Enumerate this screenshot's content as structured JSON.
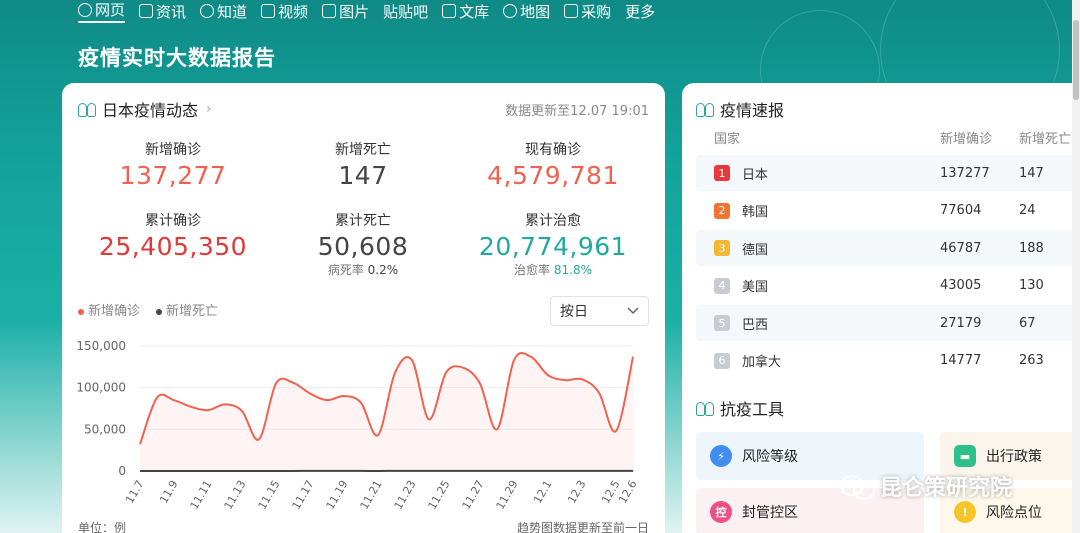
{
  "nav": {
    "items": [
      {
        "label": "网页",
        "icon": "search-icon",
        "active": true
      },
      {
        "label": "资讯",
        "icon": "news-icon"
      },
      {
        "label": "知道",
        "icon": "question-icon"
      },
      {
        "label": "视频",
        "icon": "video-icon"
      },
      {
        "label": "图片",
        "icon": "image-icon"
      },
      {
        "label": "贴贴吧",
        "icon": ""
      },
      {
        "label": "文库",
        "icon": "doc-icon"
      },
      {
        "label": "地图",
        "icon": "map-icon"
      },
      {
        "label": "采购",
        "icon": "cart-icon"
      },
      {
        "label": "更多",
        "icon": ""
      }
    ]
  },
  "page": {
    "title": "疫情实时大数据报告"
  },
  "japan": {
    "title": "日本疫情动态",
    "update": "数据更新至12.07 19:01",
    "stats": {
      "new_confirmed": {
        "label": "新增确诊",
        "value": "137,277"
      },
      "new_death": {
        "label": "新增死亡",
        "value": "147"
      },
      "current_confirmed": {
        "label": "现有确诊",
        "value": "4,579,781"
      },
      "total_confirmed": {
        "label": "累计确诊",
        "value": "25,405,350"
      },
      "total_death": {
        "label": "累计死亡",
        "value": "50,608",
        "sub_label": "病死率",
        "sub_value": "0.2%"
      },
      "total_cured": {
        "label": "累计治愈",
        "value": "20,774,961",
        "sub_label": "治愈率",
        "sub_value": "81.8%"
      }
    },
    "legend": {
      "confirmed": "新增确诊",
      "death": "新增死亡"
    },
    "select": {
      "value": "按日"
    },
    "footer_unit": "单位：例",
    "footer_note": "趋势图数据更新至前一日"
  },
  "chart_data": {
    "type": "area",
    "x": [
      "11.7",
      "11.8",
      "11.9",
      "11.10",
      "11.11",
      "11.12",
      "11.13",
      "11.14",
      "11.15",
      "11.16",
      "11.17",
      "11.18",
      "11.19",
      "11.20",
      "11.21",
      "11.22",
      "11.23",
      "11.24",
      "11.25",
      "11.26",
      "11.27",
      "11.28",
      "11.29",
      "11.30",
      "12.1",
      "12.2",
      "12.3",
      "12.4",
      "12.5",
      "12.6"
    ],
    "tick_labels": [
      "11.7",
      "11.9",
      "11.11",
      "11.13",
      "11.15",
      "11.17",
      "11.19",
      "11.21",
      "11.23",
      "11.25",
      "11.27",
      "11.29",
      "12.1",
      "12.3",
      "12.5",
      "12.6"
    ],
    "series": [
      {
        "name": "新增确诊",
        "color": "#f0624f",
        "values": [
          32000,
          88000,
          85000,
          77000,
          73000,
          80000,
          72000,
          38000,
          105000,
          106000,
          93000,
          85000,
          90000,
          82000,
          43000,
          118000,
          133000,
          62000,
          118000,
          124000,
          105000,
          50000,
          133000,
          137000,
          115000,
          109000,
          110000,
          94000,
          48000,
          137000
        ]
      },
      {
        "name": "新增死亡",
        "color": "#444444",
        "values": [
          50,
          60,
          70,
          60,
          60,
          70,
          60,
          40,
          70,
          70,
          80,
          80,
          90,
          90,
          60,
          100,
          110,
          90,
          110,
          120,
          120,
          80,
          130,
          150,
          140,
          130,
          140,
          130,
          90,
          147
        ]
      }
    ],
    "yticks": [
      "150,000",
      "100,000",
      "50,000",
      "0"
    ],
    "ylim": [
      0,
      150000
    ],
    "grid": true,
    "legend_position": "top-left"
  },
  "speed": {
    "title": "疫情速报",
    "headers": {
      "country": "国家",
      "new": "新增确诊",
      "death": "新增死亡"
    },
    "rows": [
      {
        "rank": "1",
        "country": "日本",
        "new": "137277",
        "death": "147",
        "color": "#e8383a"
      },
      {
        "rank": "2",
        "country": "韩国",
        "new": "77604",
        "death": "24",
        "color": "#f27430"
      },
      {
        "rank": "3",
        "country": "德国",
        "new": "46787",
        "death": "188",
        "color": "#f5b731"
      },
      {
        "rank": "4",
        "country": "美国",
        "new": "43005",
        "death": "130",
        "color": "#c8ccd2"
      },
      {
        "rank": "5",
        "country": "巴西",
        "new": "27179",
        "death": "67",
        "color": "#c8ccd2"
      },
      {
        "rank": "6",
        "country": "加拿大",
        "new": "14777",
        "death": "263",
        "color": "#c8ccd2"
      }
    ]
  },
  "tools": {
    "title": "抗疫工具",
    "items": [
      {
        "label": "风险等级",
        "icon": "alarm-icon",
        "color": "#3f8ef0"
      },
      {
        "label": "出行政策",
        "icon": "car-icon",
        "color": "#2fbf8a"
      },
      {
        "label": "封管控区",
        "icon": "control-icon",
        "glyph": "控",
        "color": "#f04f86"
      },
      {
        "label": "风险点位",
        "icon": "warning-icon",
        "color": "#f5c52a"
      }
    ]
  },
  "watermark": {
    "text": "昆仑策研究院"
  }
}
